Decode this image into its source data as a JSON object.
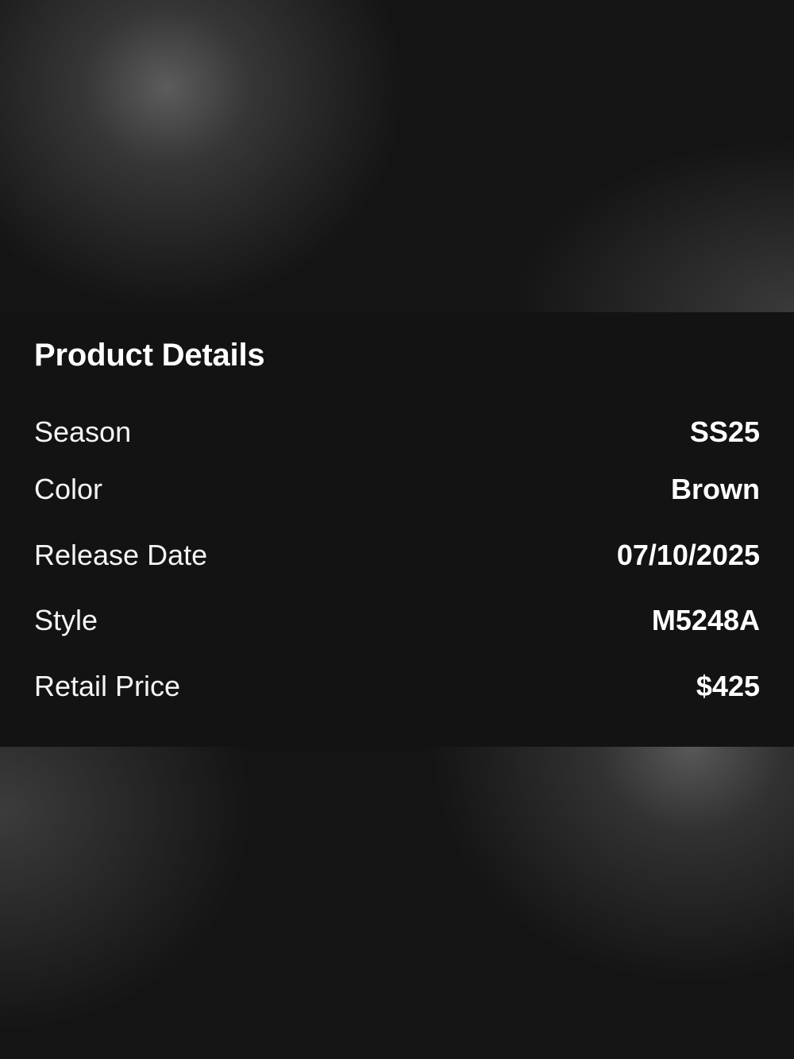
{
  "details": {
    "title": "Product Details",
    "rows": [
      {
        "label": "Season",
        "value": "SS25"
      },
      {
        "label": "Color",
        "value": "Brown"
      },
      {
        "label": "Release Date",
        "value": "07/10/2025"
      },
      {
        "label": "Style",
        "value": "M5248A"
      },
      {
        "label": "Retail Price",
        "value": "$425"
      }
    ]
  },
  "colors": {
    "background": "#141414",
    "panel": "#131313",
    "text": "#ffffff"
  }
}
